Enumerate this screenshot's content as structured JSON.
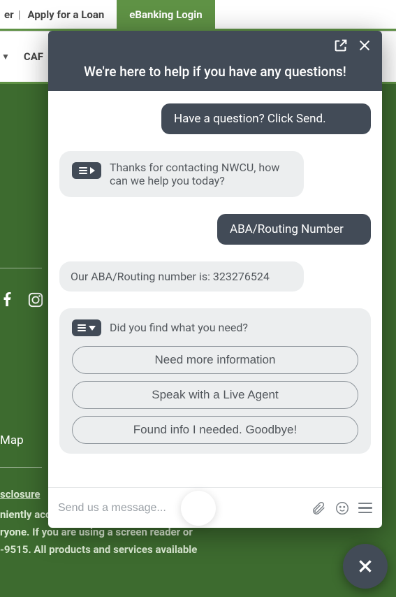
{
  "topbar": {
    "link1_suffix": "er",
    "link2": "Apply for a Loan",
    "ebanking": "eBanking Login"
  },
  "nav": {
    "item_partial": "CAF"
  },
  "chat": {
    "title": "We're here to help if you have any questions!",
    "messages": {
      "user1": "Have a question? Click Send.",
      "bot1": "Thanks for contacting NWCU, how can we help you today?",
      "user2": "ABA/Routing Number",
      "bot2": "Our ABA/Routing number is: 323276524",
      "followup_q": "Did you find what you need?"
    },
    "options": {
      "opt1": "Need more information",
      "opt2": "Speak with a Live Agent",
      "opt3": "Found info I needed. Goodbye!"
    },
    "input_placeholder": "Send us a message..."
  },
  "footer": {
    "map": "Map",
    "disclosure": "sclosure",
    "line1": "niently accessible to",
    "line2": "ryone. If you are using a screen reader or",
    "line3": "-9515. All products and services available"
  }
}
